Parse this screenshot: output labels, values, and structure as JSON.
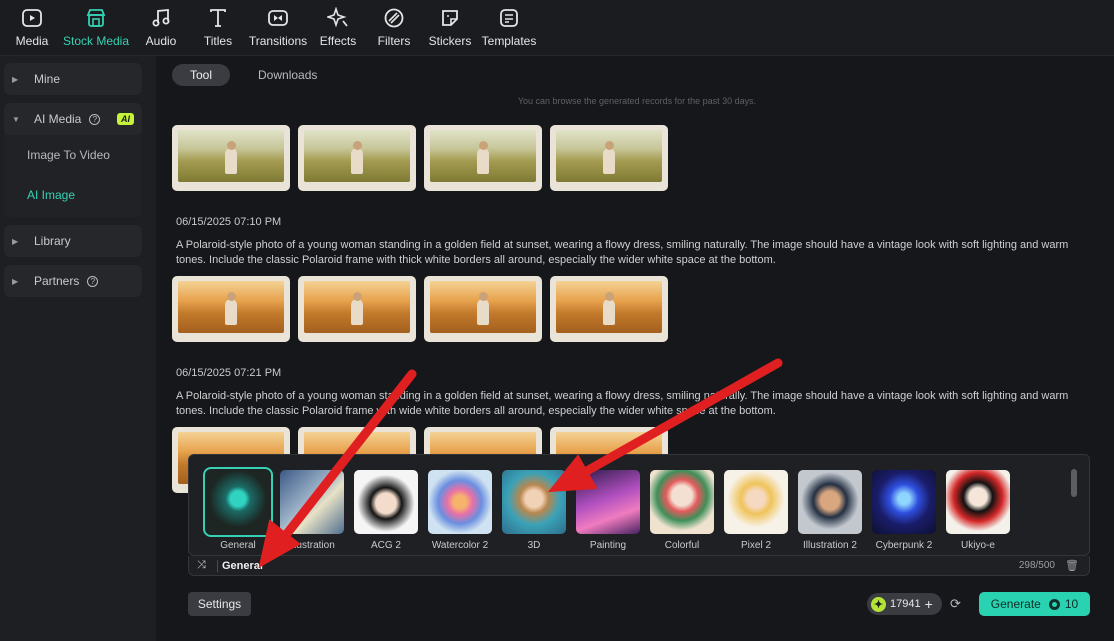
{
  "toolbar": {
    "items": [
      {
        "label": "Media",
        "icon": "media-icon"
      },
      {
        "label": "Stock Media",
        "icon": "stock-media-icon",
        "active": true
      },
      {
        "label": "Audio",
        "icon": "music-note-icon"
      },
      {
        "label": "Titles",
        "icon": "text-t-icon"
      },
      {
        "label": "Transitions",
        "icon": "transition-icon"
      },
      {
        "label": "Effects",
        "icon": "sparkle-icon"
      },
      {
        "label": "Filters",
        "icon": "filter-icon"
      },
      {
        "label": "Stickers",
        "icon": "sticker-icon"
      },
      {
        "label": "Templates",
        "icon": "template-icon"
      }
    ],
    "accent": "#36d1b4"
  },
  "sidebar": {
    "mine": "Mine",
    "ai_media": "AI Media",
    "ai_badge": "AI",
    "image_to_video": "Image To Video",
    "ai_image": "AI Image",
    "library": "Library",
    "partners": "Partners"
  },
  "main": {
    "tabs": [
      {
        "label": "Tool",
        "active": true
      },
      {
        "label": "Downloads"
      }
    ],
    "records_note": "You can browse the generated records for the past 30 days.",
    "entries": [
      {
        "timestamp": "06/15/2025 07:10 PM",
        "prompt": "A Polaroid-style photo of a young woman standing in a golden field at sunset, wearing a flowy dress, smiling naturally. The image should have a vintage look with soft lighting and warm tones. Include the classic Polaroid frame with thick white borders all around, especially the wider white space at the bottom."
      },
      {
        "timestamp": "06/15/2025 07:21 PM",
        "prompt": "A Polaroid-style photo of a young woman standing in a golden field at sunset, wearing a flowy dress, smiling naturally. The image should have a vintage look with soft lighting and warm tones. Include the classic Polaroid frame with wide white borders all around, especially the wider white space at the bottom."
      }
    ]
  },
  "styles": {
    "items": [
      {
        "label": "General",
        "selected": true
      },
      {
        "label": "Illustration"
      },
      {
        "label": "ACG 2"
      },
      {
        "label": "Watercolor 2"
      },
      {
        "label": "3D"
      },
      {
        "label": "Painting"
      },
      {
        "label": "Colorful"
      },
      {
        "label": "Pixel 2"
      },
      {
        "label": "Illustration 2"
      },
      {
        "label": "Cyberpunk 2"
      },
      {
        "label": "Ukiyo-e"
      }
    ],
    "current": "General",
    "char_count": "298/500"
  },
  "bottom": {
    "settings": "Settings",
    "credits": "17941",
    "generate": "Generate",
    "generate_cost": "10"
  },
  "annotation_color": "#e02020"
}
